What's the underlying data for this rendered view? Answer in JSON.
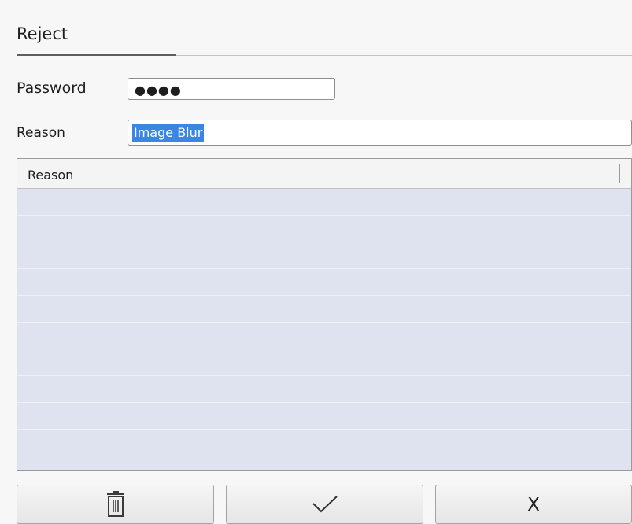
{
  "dialog": {
    "title": "Reject",
    "password": {
      "label": "Password",
      "masked_value": "●●●●"
    },
    "reason": {
      "label": "Reason",
      "value": "Image Blur"
    },
    "table": {
      "columns": [
        "Reason"
      ],
      "rows": []
    },
    "buttons": {
      "delete_icon": "trash-icon",
      "confirm_icon": "checkmark-icon",
      "cancel_label": "X"
    }
  }
}
